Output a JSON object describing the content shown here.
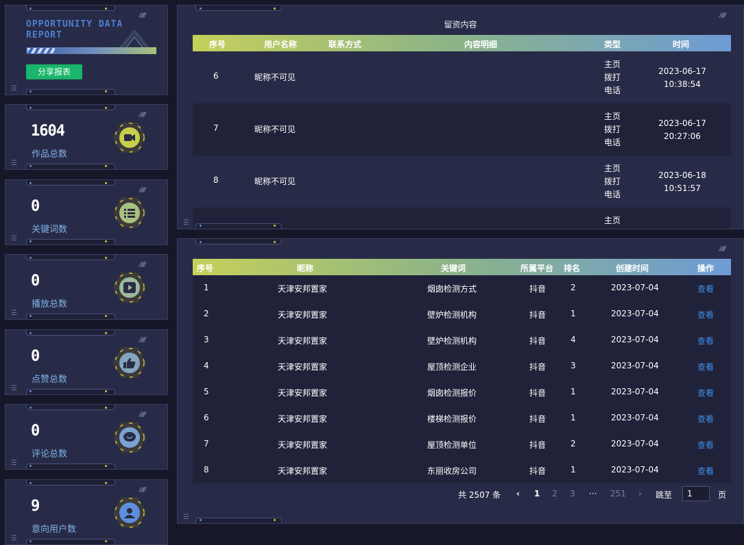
{
  "header": {
    "logo_line1": "OPPORTUNITY DATA",
    "logo_line2": "REPORT",
    "share_button": "分享报表"
  },
  "stats": [
    {
      "value": "1604",
      "label": "作品总数",
      "icon": "video-camera-icon",
      "icon_color": "#c7cf4a"
    },
    {
      "value": "0",
      "label": "关键词数",
      "icon": "list-icon",
      "icon_color": "#a9c180"
    },
    {
      "value": "0",
      "label": "播放总数",
      "icon": "play-icon",
      "icon_color": "#9bb99c"
    },
    {
      "value": "0",
      "label": "点赞总数",
      "icon": "thumbs-up-icon",
      "icon_color": "#84a6bd"
    },
    {
      "value": "0",
      "label": "评论总数",
      "icon": "comment-icon",
      "icon_color": "#7aa3d4"
    },
    {
      "value": "9",
      "label": "意向用户数",
      "icon": "user-icon",
      "icon_color": "#5f8fdc"
    }
  ],
  "leads_table": {
    "title": "留资内容",
    "columns": [
      "序号",
      "用户名称",
      "联系方式",
      "内容明细",
      "类型",
      "时间"
    ],
    "rows": [
      {
        "no": "6",
        "name": "昵称不可见",
        "contact": "",
        "detail": "",
        "type": [
          "主页",
          "拨打",
          "电话"
        ],
        "date": "2023-06-17",
        "time": "10:38:54"
      },
      {
        "no": "7",
        "name": "昵称不可见",
        "contact": "",
        "detail": "",
        "type": [
          "主页",
          "拨打",
          "电话"
        ],
        "date": "2023-06-17",
        "time": "20:27:06"
      },
      {
        "no": "8",
        "name": "昵称不可见",
        "contact": "",
        "detail": "",
        "type": [
          "主页",
          "拨打",
          "电话"
        ],
        "date": "2023-06-18",
        "time": "10:51:57"
      },
      {
        "no": "",
        "name": "",
        "contact": "",
        "detail": "",
        "type": [
          "主页"
        ],
        "date": "",
        "time": ""
      }
    ]
  },
  "ranking_table": {
    "columns": [
      "序号",
      "昵称",
      "关键词",
      "所属平台",
      "排名",
      "创建时间",
      "操作"
    ],
    "rows": [
      {
        "no": "1",
        "nickname": "天津安邦置家",
        "keyword": "烟囱检测方式",
        "platform": "抖音",
        "rank": "2",
        "created": "2023-07-04",
        "action": "查看"
      },
      {
        "no": "2",
        "nickname": "天津安邦置家",
        "keyword": "壁炉检测机构",
        "platform": "抖音",
        "rank": "1",
        "created": "2023-07-04",
        "action": "查看"
      },
      {
        "no": "3",
        "nickname": "天津安邦置家",
        "keyword": "壁炉检测机构",
        "platform": "抖音",
        "rank": "4",
        "created": "2023-07-04",
        "action": "查看"
      },
      {
        "no": "4",
        "nickname": "天津安邦置家",
        "keyword": "屋顶检测企业",
        "platform": "抖音",
        "rank": "3",
        "created": "2023-07-04",
        "action": "查看"
      },
      {
        "no": "5",
        "nickname": "天津安邦置家",
        "keyword": "烟囱检测报价",
        "platform": "抖音",
        "rank": "1",
        "created": "2023-07-04",
        "action": "查看"
      },
      {
        "no": "6",
        "nickname": "天津安邦置家",
        "keyword": "楼梯检测报价",
        "platform": "抖音",
        "rank": "1",
        "created": "2023-07-04",
        "action": "查看"
      },
      {
        "no": "7",
        "nickname": "天津安邦置家",
        "keyword": "屋顶检测单位",
        "platform": "抖音",
        "rank": "2",
        "created": "2023-07-04",
        "action": "查看"
      },
      {
        "no": "8",
        "nickname": "天津安邦置家",
        "keyword": "东丽收房公司",
        "platform": "抖音",
        "rank": "1",
        "created": "2023-07-04",
        "action": "查看"
      }
    ]
  },
  "pagination": {
    "total": "共 2507 条",
    "prev": "‹",
    "pages": [
      "1",
      "2",
      "3",
      "···",
      "251"
    ],
    "current": "1",
    "next": "›",
    "jump_label": "跳至",
    "jump_value": "1",
    "page_suffix": "页"
  },
  "colors": {
    "page_bg": "#161829",
    "panel_bg": "#282b47",
    "share_green": "#19b56a",
    "link_blue": "#3d8fea",
    "label_blue": "#7fb2e6"
  }
}
